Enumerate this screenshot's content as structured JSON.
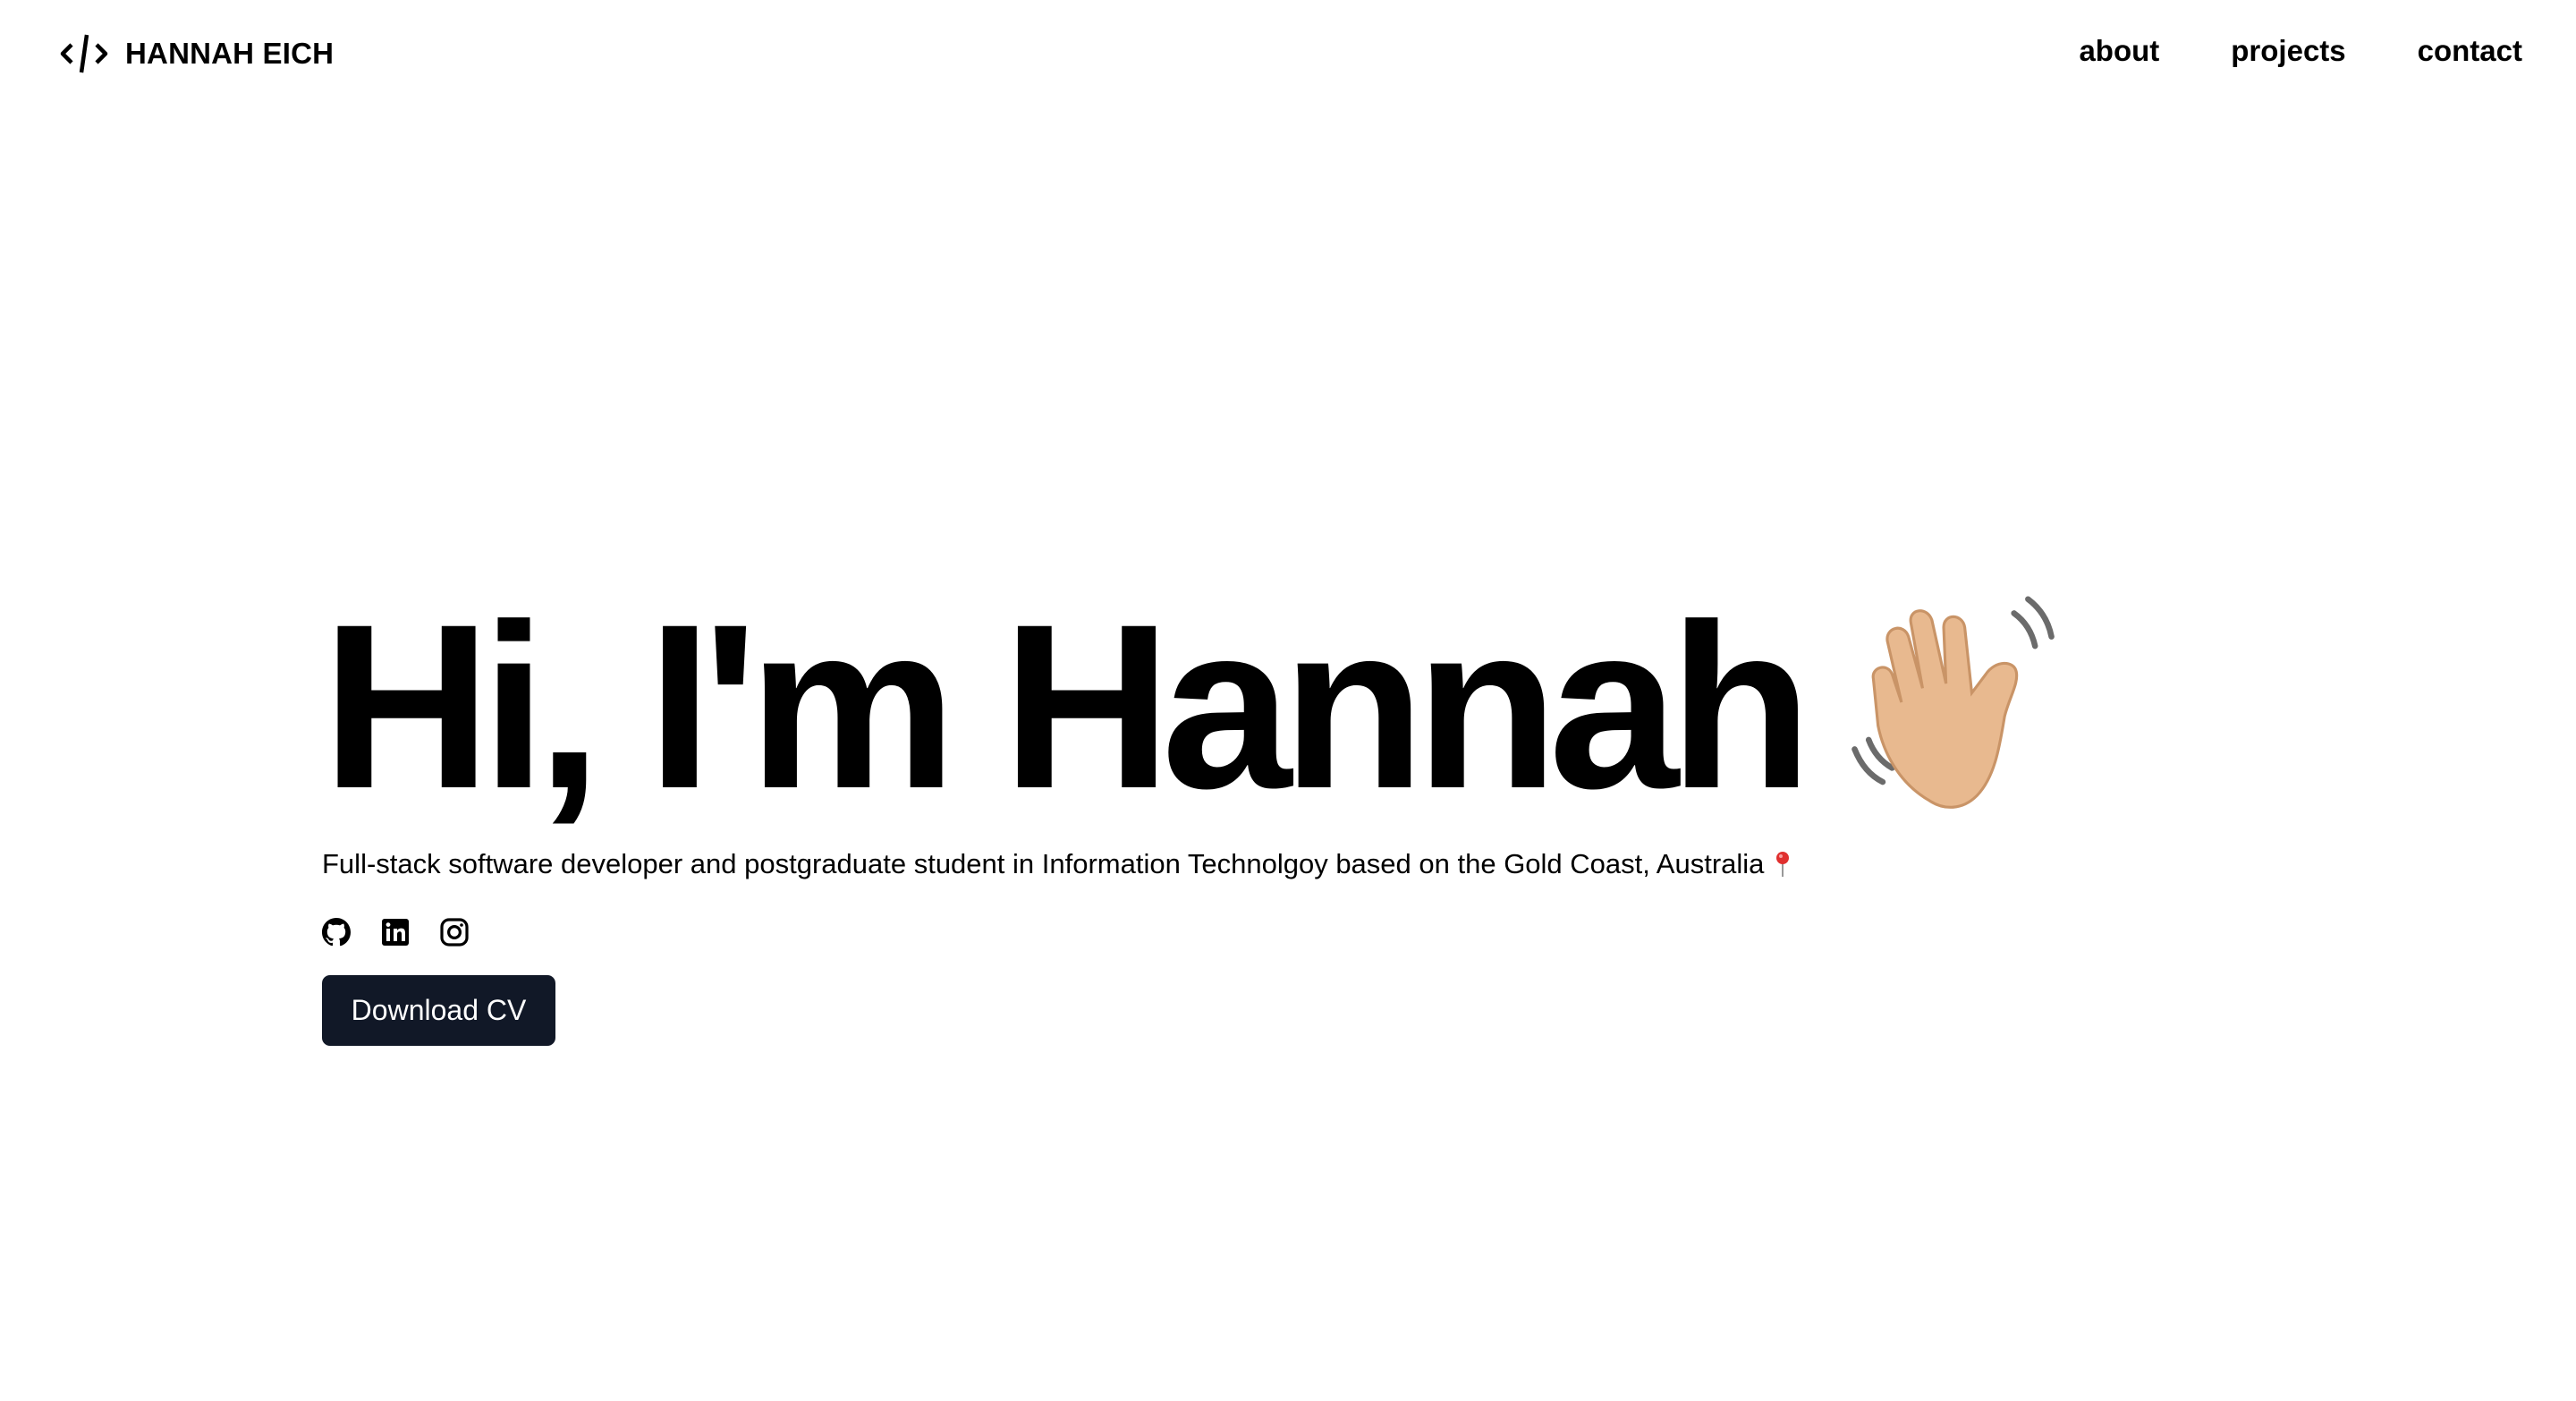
{
  "header": {
    "logo_icon": "code-slash-icon",
    "brand": "HANNAH EICH",
    "nav": [
      {
        "label": "about"
      },
      {
        "label": "projects"
      },
      {
        "label": "contact"
      }
    ]
  },
  "hero": {
    "title": "Hi, I'm Hannah",
    "title_icon": "waving-hand-emoji",
    "subtitle": "Full-stack software developer and postgraduate student in Information Technolgoy based on the Gold Coast, Australia",
    "subtitle_icon": "round-pushpin-emoji",
    "socials": [
      {
        "icon": "github-icon"
      },
      {
        "icon": "linkedin-icon"
      },
      {
        "icon": "instagram-icon"
      }
    ],
    "cta_label": "Download CV",
    "cta_color": "#111827"
  }
}
